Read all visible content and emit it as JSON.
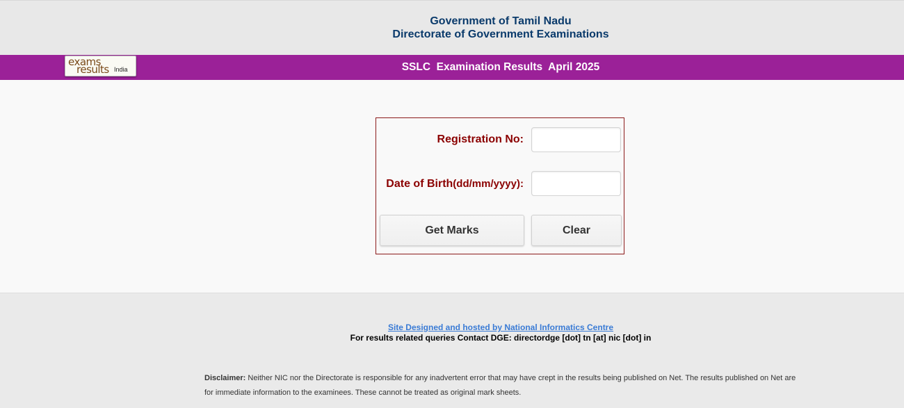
{
  "header": {
    "line1": "Government of Tamil Nadu",
    "line2": "Directorate of Government Examinations"
  },
  "banner": {
    "logo_line1": "exams",
    "logo_line2": "results",
    "logo_line3": "India",
    "title": "SSLC  Examination Results  April 2025"
  },
  "form": {
    "registration_label": "Registration No:",
    "registration_value": "",
    "dob_label_main": "Date of Birth",
    "dob_label_format": "(dd/mm/yyyy):",
    "dob_value": "",
    "get_marks_label": "Get Marks",
    "clear_label": "Clear"
  },
  "footer": {
    "credit": "Site Designed and hosted by National Informatics Centre",
    "contact": "For results related queries Contact DGE:  directordge [dot] tn [at] nic [dot] in",
    "disclaimer_label": "Disclaimer:",
    "disclaimer_text": " Neither NIC nor the Directorate is responsible for any inadvertent error that may have crept in the results being published on Net. The results published on Net are for immediate information to the examinees. These cannot be treated as original mark sheets."
  },
  "colors": {
    "banner": "#9b2198",
    "header_text": "#0a3a6b",
    "label_text": "#8b0000",
    "link": "#3a7bd5"
  }
}
